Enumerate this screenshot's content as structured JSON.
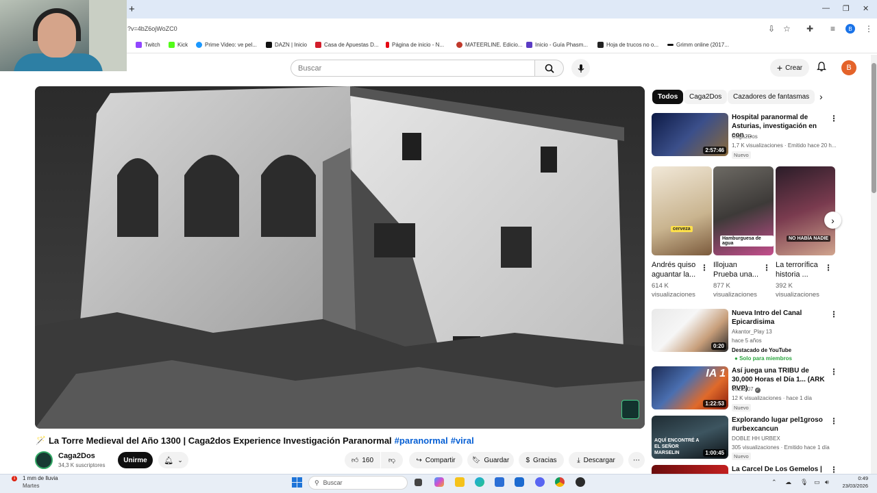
{
  "browser": {
    "new_tab": "+",
    "url": "?v=4bZ6ojWoZC0",
    "window_controls": {
      "minimize": "—",
      "restore": "❐",
      "close": "✕"
    },
    "bookmarks": [
      {
        "label": "Twitch",
        "color": "#9146ff"
      },
      {
        "label": "Kick",
        "color": "#53fc18"
      },
      {
        "label": "Prime Video: ve pel...",
        "color": "#1a98ff"
      },
      {
        "label": "DAZN | Inicio",
        "color": "#111111"
      },
      {
        "label": "Casa de Apuestas D...",
        "color": "#d21e2b"
      },
      {
        "label": "Página de inicio - N...",
        "color": "#e50914"
      },
      {
        "label": "MATEERLINE. Edicio...",
        "color": "#c0392b"
      },
      {
        "label": "Inicio - Guía Phasm...",
        "color": "#5b3cc4"
      },
      {
        "label": "Hoja de trucos no o...",
        "color": "#222222"
      },
      {
        "label": "Grimm online (2017...",
        "color": "#111111"
      }
    ]
  },
  "header": {
    "search_placeholder": "Buscar",
    "create_label": "Crear",
    "avatar_letter": "B"
  },
  "video": {
    "title": "La Torre Medieval del Año 1300 | Caga2dos Experience Investigación Paranormal",
    "hashtags": [
      "#paranormal",
      "#viral"
    ],
    "channel": "Caga2Dos",
    "subscribers": "34,3 K suscriptores",
    "join_label": "Unirme",
    "likes": "160",
    "share_label": "Compartir",
    "save_label": "Guardar",
    "thanks_label": "Gracias",
    "download_label": "Descargar"
  },
  "chips": [
    {
      "label": "Todos",
      "active": true
    },
    {
      "label": "Caga2Dos",
      "active": false
    },
    {
      "label": "Cazadores de fantasmas",
      "active": false
    }
  ],
  "recommendations": [
    {
      "title": "Hospital paranormal de Asturias, investigación en con ...",
      "channel": "Caga2Dos",
      "meta": "1,7 K visualizaciones · Emitido hace 20 h...",
      "badge": "Nuevo",
      "duration": "2:57:46"
    },
    {
      "title": "Nueva Intro del Canal Epicardisima",
      "channel": "Akantor_Play 13",
      "meta": "hace 5 años",
      "extra": "Destacado de YouTube",
      "members": "Solo para miembros",
      "duration": "0:20"
    },
    {
      "title": "Así juega una TRIBU de 30,000 Horas el Día 1... (ARK PVP)",
      "channel": "Vector07",
      "meta": "12 K visualizaciones · hace 1 día",
      "badge": "Nuevo",
      "duration": "1:22:53",
      "thumb_text": "IA 1"
    },
    {
      "title": "Explorando lugar pel1groso #urbexcancun",
      "channel": "DOBLE HH URBEX",
      "meta": "305 visualizaciones · Emitido hace 1 día",
      "badge": "Nuevo",
      "duration": "1:00:45",
      "thumb_text": "AQUÍ ENCONTRÉ A EL SEÑOR MARSELIN"
    },
    {
      "title": "La Carcel De Los Gemelos |"
    }
  ],
  "shorts": [
    {
      "title": "Andrés quiso aguantar la...",
      "views": "614 K visualizaciones",
      "caption": "cerveza"
    },
    {
      "title": "Illojuan Prueba una...",
      "views": "877 K visualizaciones",
      "caption": "Hamburguesa de agua"
    },
    {
      "title": "La terrorífica historia ...",
      "views": "392 K visualizaciones",
      "caption": "NO HABÍA NADIE"
    }
  ],
  "taskbar": {
    "weather_line1": "1 mm de lluvia",
    "weather_line2": "Martes",
    "search_placeholder": "Buscar",
    "time": "0:49",
    "date": "23/03/2026"
  }
}
